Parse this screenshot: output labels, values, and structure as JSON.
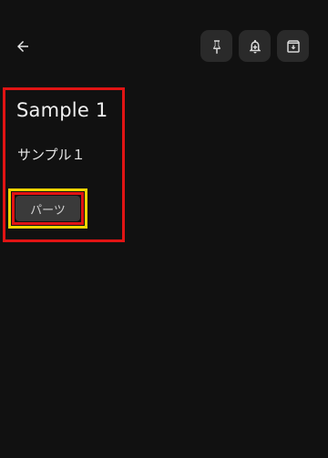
{
  "toolbar": {
    "back_icon": "arrow-left-icon",
    "pin_icon": "pin-icon",
    "reminder_icon": "bell-plus-icon",
    "archive_icon": "archive-icon"
  },
  "note": {
    "title": "Sample 1",
    "body": "サンプル１",
    "labels": [
      "パーツ"
    ]
  },
  "colors": {
    "background": "#111111",
    "button_bg": "#2a2a2a",
    "chip_bg": "#3a3a3a",
    "highlight_red": "#e11414",
    "highlight_yellow": "#f0d400"
  }
}
